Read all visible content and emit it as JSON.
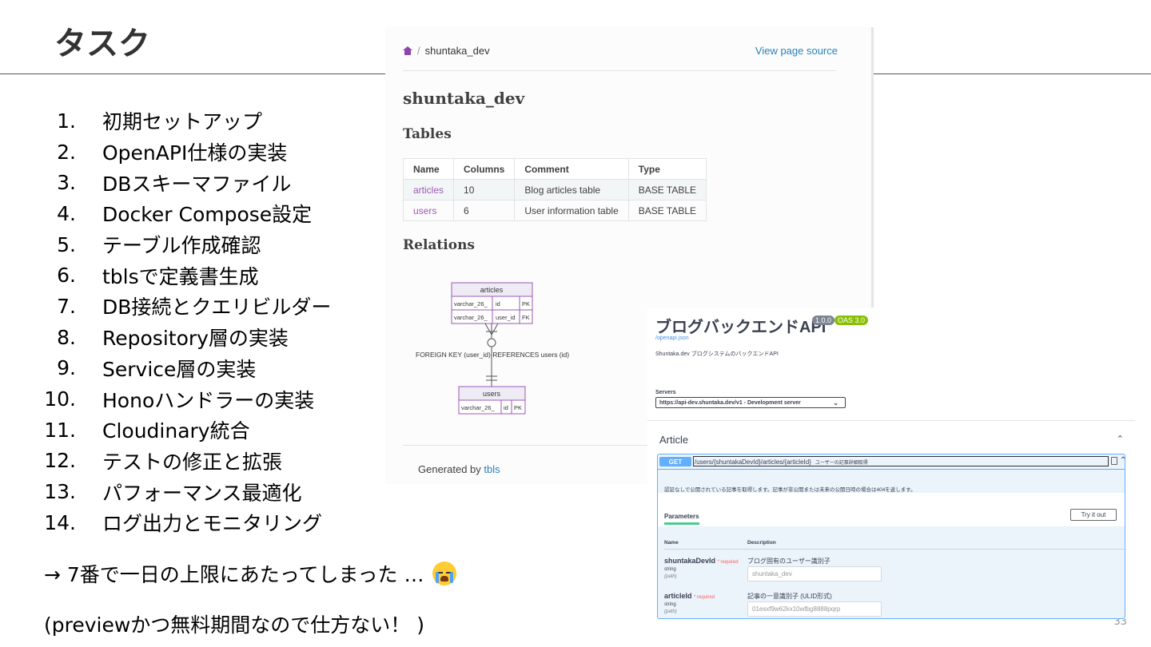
{
  "slide": {
    "title": "タスク",
    "page_number": "33"
  },
  "tasks": [
    {
      "num": "1.",
      "text": "初期セットアップ"
    },
    {
      "num": "2.",
      "text": "OpenAPI仕様の実装"
    },
    {
      "num": "3.",
      "text": "DBスキーマファイル"
    },
    {
      "num": "4.",
      "text": "Docker Compose設定"
    },
    {
      "num": "5.",
      "text": "テーブル作成確認"
    },
    {
      "num": "6.",
      "text": "tblsで定義書生成"
    },
    {
      "num": "7.",
      "text": "DB接続とクエリビルダー"
    },
    {
      "num": "8.",
      "text": "Repository層の実装"
    },
    {
      "num": "9.",
      "text": "Service層の実装"
    },
    {
      "num": "10.",
      "text": "Honoハンドラーの実装"
    },
    {
      "num": "11.",
      "text": "Cloudinary統合"
    },
    {
      "num": "12.",
      "text": "テストの修正と拡張"
    },
    {
      "num": "13.",
      "text": "パフォーマンス最適化"
    },
    {
      "num": "14.",
      "text": "ログ出力とモニタリング"
    }
  ],
  "notes": {
    "line1": "→ 7番で一日の上限にあたってしまった …",
    "emoji": "loudly-crying-face-icon",
    "line2": "(previewかつ無料期間なので仕方ない！ )"
  },
  "tbls": {
    "breadcrumb_sep": "/",
    "breadcrumb_current": "shuntaka_dev",
    "view_source": "View page source",
    "heading": "shuntaka_dev",
    "tables_heading": "Tables",
    "table_headers": [
      "Name",
      "Columns",
      "Comment",
      "Type"
    ],
    "table_rows": [
      {
        "name": "articles",
        "columns": "10",
        "comment": "Blog articles table",
        "type": "BASE TABLE"
      },
      {
        "name": "users",
        "columns": "6",
        "comment": "User information table",
        "type": "BASE TABLE"
      }
    ],
    "relations_heading": "Relations",
    "er": {
      "articles_title": "articles",
      "articles_rows": [
        {
          "type": "varchar_26_",
          "col": "id",
          "key": "PK"
        },
        {
          "type": "varchar_26_",
          "col": "user_id",
          "key": "FK"
        }
      ],
      "relation_label": "FOREIGN KEY (user_id) REFERENCES users (id)",
      "users_title": "users",
      "users_rows": [
        {
          "type": "varchar_26_",
          "col": "id",
          "key": "PK"
        }
      ]
    },
    "footer_prefix": "Generated by ",
    "footer_link": "tbls"
  },
  "swagger": {
    "title": "ブログバックエンドAPI",
    "version": "1.0.0",
    "oas": "OAS 3.0",
    "spec_link": "/openapi.json",
    "description": "Shuntaka.dev ブログシステムのバックエンドAPI",
    "servers_label": "Servers",
    "server_selected": "https://api-dev.shuntaka.dev/v1 - Development server",
    "tag": "Article",
    "operation": {
      "method": "GET",
      "path": "/users/{shuntakaDevId}/articles/{articleId}",
      "summary": "ユーザーの記事詳細取得",
      "description": "認証なしで公開されている記事を取得します。記事が非公開または未来の公開日時の場合は404を返します。",
      "params_tab": "Parameters",
      "try_button": "Try it out",
      "col_name": "Name",
      "col_desc": "Description",
      "params": [
        {
          "name": "shuntakaDevId",
          "required": "* required",
          "type": "string",
          "in": "(path)",
          "desc": "ブログ固有のユーザー識別子",
          "placeholder": "shuntaka_dev"
        },
        {
          "name": "articleId",
          "required": "* required",
          "type": "string",
          "in": "(path)",
          "desc": "記事の一意識別子 (ULID形式)",
          "placeholder": "01esxf9w62kx10wfbg8888pqrp"
        }
      ]
    }
  }
}
